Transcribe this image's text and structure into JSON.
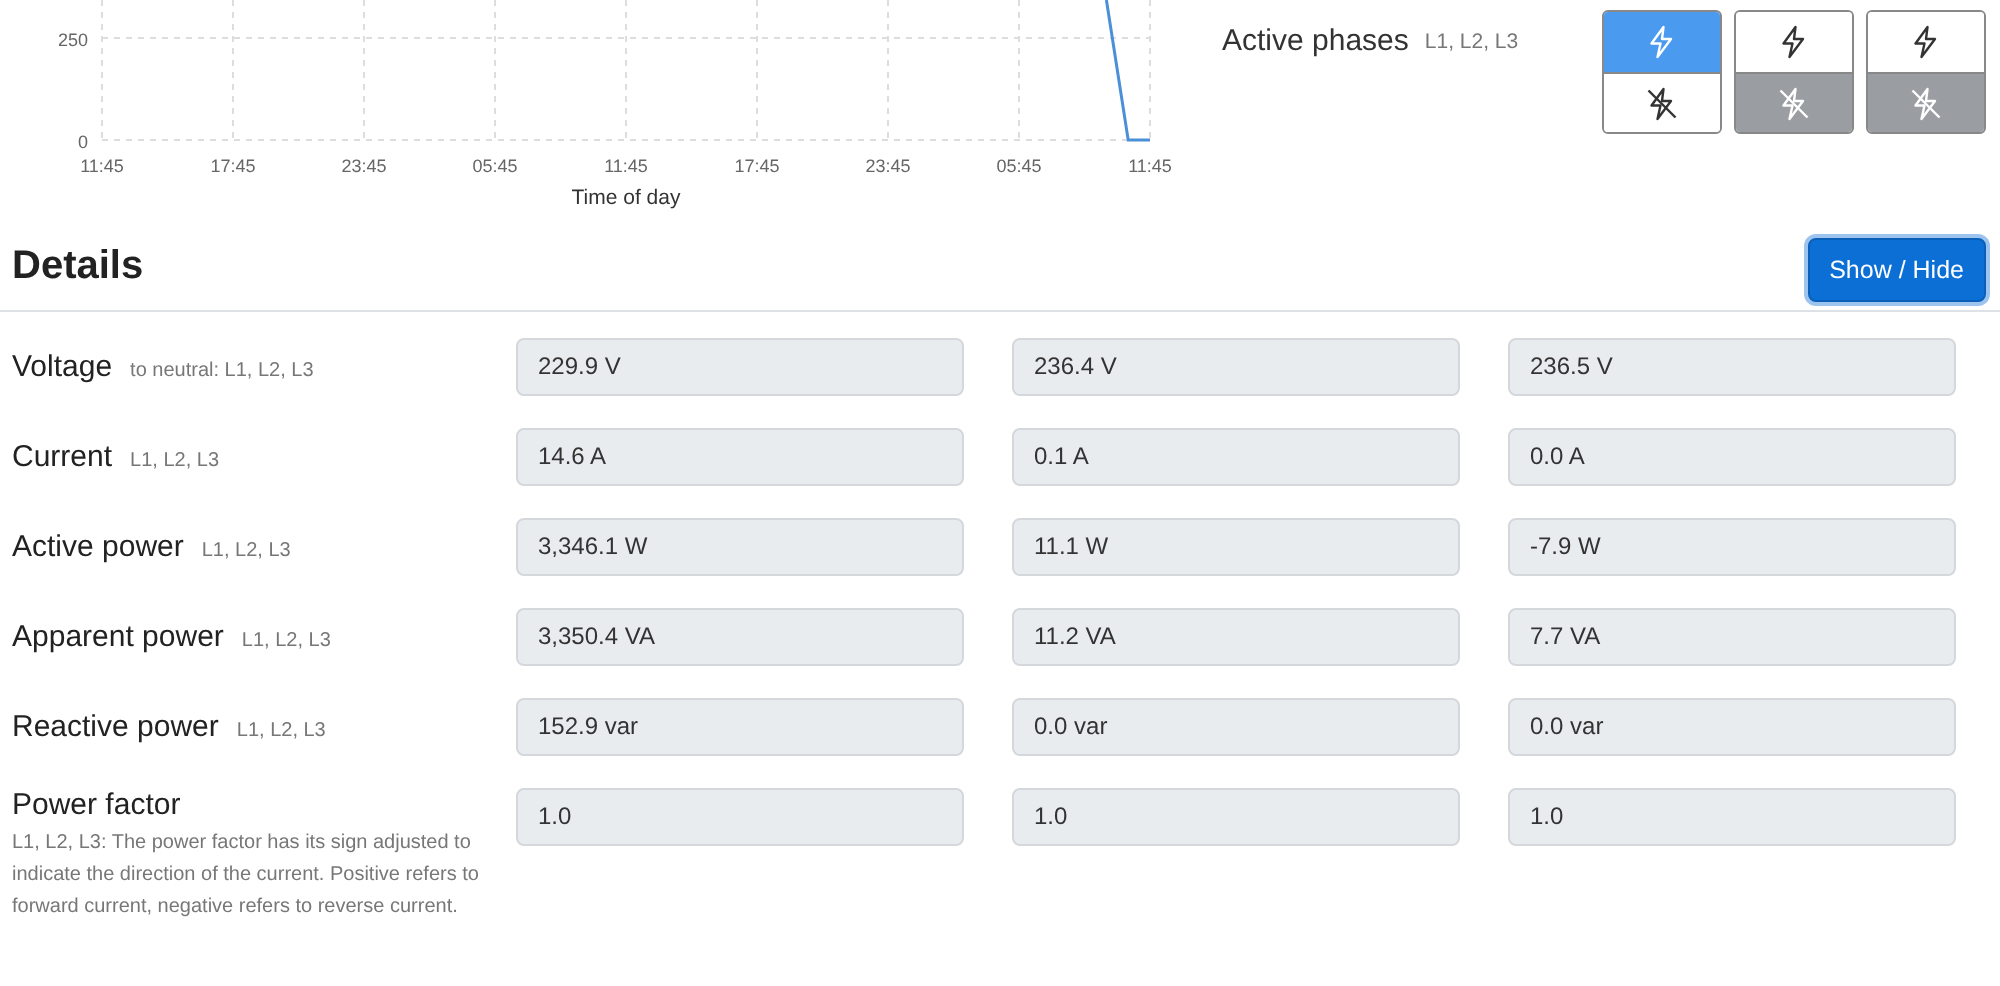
{
  "chart": {
    "chart_data": {
      "type": "line",
      "xlabel": "Time of day",
      "categories": [
        "11:45",
        null,
        null,
        null,
        null,
        null,
        "17:45",
        null,
        null,
        null,
        null,
        null,
        "23:45",
        null,
        null,
        null,
        null,
        null,
        "05:45",
        null,
        null,
        null,
        null,
        null,
        "11:45",
        null,
        null,
        null,
        null,
        null,
        "17:45",
        null,
        null,
        null,
        null,
        null,
        "23:45",
        null,
        null,
        null,
        null,
        null,
        "05:45",
        null,
        null,
        null,
        null,
        null,
        "11:45"
      ],
      "series": [
        {
          "color": "#4a90d9",
          "values": [
            null,
            null,
            null,
            null,
            null,
            null,
            null,
            null,
            null,
            null,
            null,
            null,
            null,
            null,
            null,
            null,
            null,
            null,
            null,
            null,
            null,
            null,
            null,
            null,
            null,
            null,
            null,
            null,
            null,
            null,
            null,
            null,
            null,
            null,
            null,
            null,
            null,
            null,
            null,
            null,
            null,
            null,
            null,
            null,
            null,
            null,
            343,
            0,
            0
          ]
        }
      ],
      "ylim": [
        0,
        343
      ],
      "grid": true,
      "yticks": [
        0,
        250
      ]
    }
  },
  "active_phases": {
    "label": "Active phases",
    "note": "L1, L2, L3",
    "phases": [
      {
        "on": true
      },
      {
        "on": false
      },
      {
        "on": false
      }
    ]
  },
  "details": {
    "title": "Details",
    "button": "Show / Hide",
    "rows": [
      {
        "label": "Voltage",
        "note": "to neutral: L1, L2, L3",
        "values": [
          "229.9 V",
          "236.4 V",
          "236.5 V"
        ]
      },
      {
        "label": "Current",
        "note": "L1, L2, L3",
        "values": [
          "14.6 A",
          "0.1 A",
          "0.0 A"
        ]
      },
      {
        "label": "Active power",
        "note": "L1, L2, L3",
        "values": [
          "3,346.1 W",
          "11.1 W",
          "-7.9 W"
        ]
      },
      {
        "label": "Apparent power",
        "note": "L1, L2, L3",
        "values": [
          "3,350.4 VA",
          "11.2 VA",
          "7.7 VA"
        ]
      },
      {
        "label": "Reactive power",
        "note": "L1, L2, L3",
        "values": [
          "152.9 var",
          "0.0 var",
          "0.0 var"
        ]
      },
      {
        "label": "Power factor",
        "kind": "long_note",
        "note": "L1, L2, L3: The power factor has its sign adjusted to indicate the direction of the current. Positive refers to forward current, negative refers to reverse current.",
        "values": [
          "1.0",
          "1.0",
          "1.0"
        ]
      }
    ]
  }
}
